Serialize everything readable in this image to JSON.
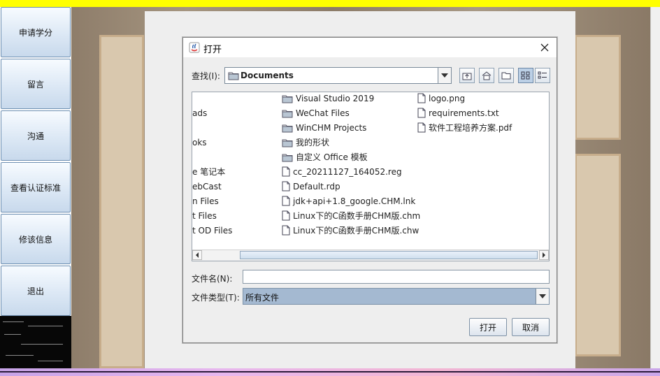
{
  "sidebar": {
    "items": [
      {
        "label": "申请学分"
      },
      {
        "label": "留言"
      },
      {
        "label": "沟通"
      },
      {
        "label": "查看认证标准"
      },
      {
        "label": "修该信息"
      },
      {
        "label": "退出"
      }
    ]
  },
  "dialog": {
    "title": "打开",
    "look_in_label": "查找(I):",
    "look_in_value": "Documents",
    "file_name_label": "文件名(N):",
    "file_name_value": "",
    "file_type_label": "文件类型(T):",
    "file_type_value": "所有文件",
    "open_label": "打开",
    "cancel_label": "取消",
    "toolbar_icons": [
      "up-one-level-icon",
      "home-icon",
      "new-folder-icon",
      "list-view-icon",
      "details-view-icon"
    ],
    "files_col1": [
      "ads",
      "oks",
      "e 笔记本",
      "ebCast",
      "n Files",
      "t Files",
      "t OD Files"
    ],
    "files_col2": [
      {
        "name": "Visual Studio 2019",
        "type": "folder"
      },
      {
        "name": "WeChat Files",
        "type": "folder"
      },
      {
        "name": "WinCHM Projects",
        "type": "folder"
      },
      {
        "name": "我的形状",
        "type": "folder"
      },
      {
        "name": "自定义 Office 模板",
        "type": "folder"
      },
      {
        "name": "cc_20211127_164052.reg",
        "type": "file"
      },
      {
        "name": "Default.rdp",
        "type": "file"
      },
      {
        "name": "jdk+api+1.8_google.CHM.lnk",
        "type": "file"
      },
      {
        "name": "Linux下的C函数手册CHM版.chm",
        "type": "file"
      },
      {
        "name": "Linux下的C函数手册CHM版.chw",
        "type": "file"
      }
    ],
    "files_col3": [
      {
        "name": "logo.png",
        "type": "file"
      },
      {
        "name": "requirements.txt",
        "type": "file"
      },
      {
        "name": "软件工程培养方案.pdf",
        "type": "file"
      }
    ]
  },
  "colors": {
    "top_bar": "#ffff00",
    "sidebar_button": "#dce8f5",
    "selected_type": "#a4b9d1"
  }
}
